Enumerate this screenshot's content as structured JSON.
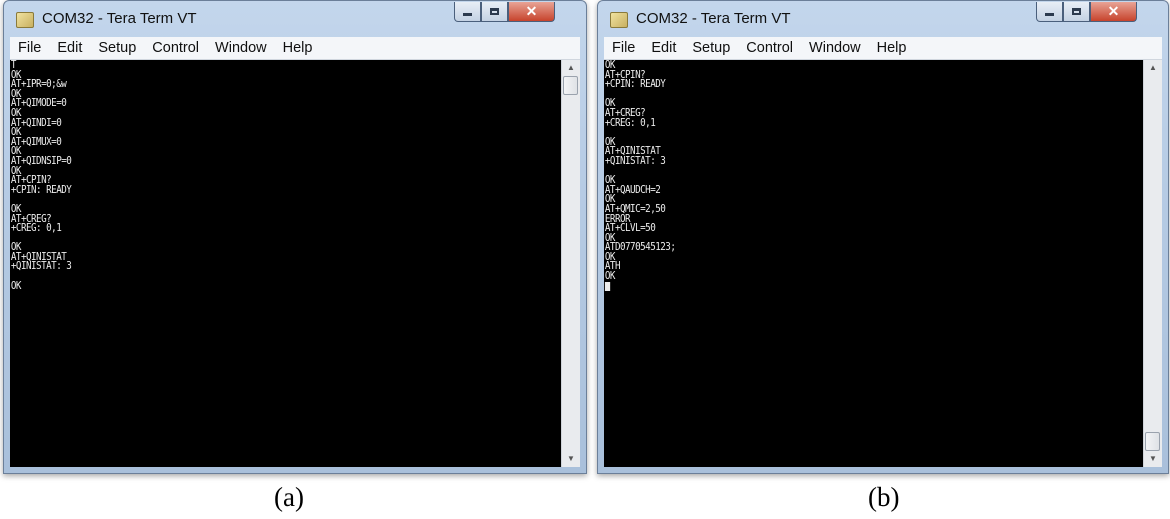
{
  "windows": [
    {
      "title": "COM32 - Tera Term VT",
      "menu": [
        "File",
        "Edit",
        "Setup",
        "Control",
        "Window",
        "Help"
      ],
      "lines": [
        "T",
        "OK",
        "AT+IPR=0;&w",
        "OK",
        "AT+QIMODE=0",
        "OK",
        "AT+QINDI=0",
        "OK",
        "AT+QIMUX=0",
        "OK",
        "AT+QIDNSIP=0",
        "OK",
        "AT+CPIN?",
        "+CPIN: READY",
        "",
        "OK",
        "AT+CREG?",
        "+CREG: 0,1",
        "",
        "OK",
        "AT+QINISTAT",
        "+QINISTAT: 3",
        "",
        "OK"
      ],
      "scroll_position": 0,
      "caption": "(a)",
      "icons": {
        "app": "app-icon",
        "minimize": "minimize-icon",
        "maximize": "maximize-icon",
        "close": "close-icon",
        "up": "scroll-up-icon",
        "down": "scroll-down-icon"
      }
    },
    {
      "title": "COM32 - Tera Term VT",
      "menu": [
        "File",
        "Edit",
        "Setup",
        "Control",
        "Window",
        "Help"
      ],
      "lines": [
        "OK",
        "AT+CPIN?",
        "+CPIN: READY",
        "",
        "OK",
        "AT+CREG?",
        "+CREG: 0,1",
        "",
        "OK",
        "AT+QINISTAT",
        "+QINISTAT: 3",
        "",
        "OK",
        "AT+QAUDCH=2",
        "OK",
        "AT+QMIC=2,50",
        "ERROR",
        "AT+CLVL=50",
        "OK",
        "ATD0770545123;",
        "OK",
        "ATH",
        "OK"
      ],
      "cursor": true,
      "scroll_position": 1,
      "caption": "(b)",
      "icons": {
        "app": "app-icon",
        "minimize": "minimize-icon",
        "maximize": "maximize-icon",
        "close": "close-icon",
        "up": "scroll-up-icon",
        "down": "scroll-down-icon"
      }
    }
  ],
  "colors": {
    "terminal_bg": "#000000",
    "terminal_fg": "#ececec",
    "close_button": "#c7432c",
    "title_bar": "#b6cbe4"
  }
}
